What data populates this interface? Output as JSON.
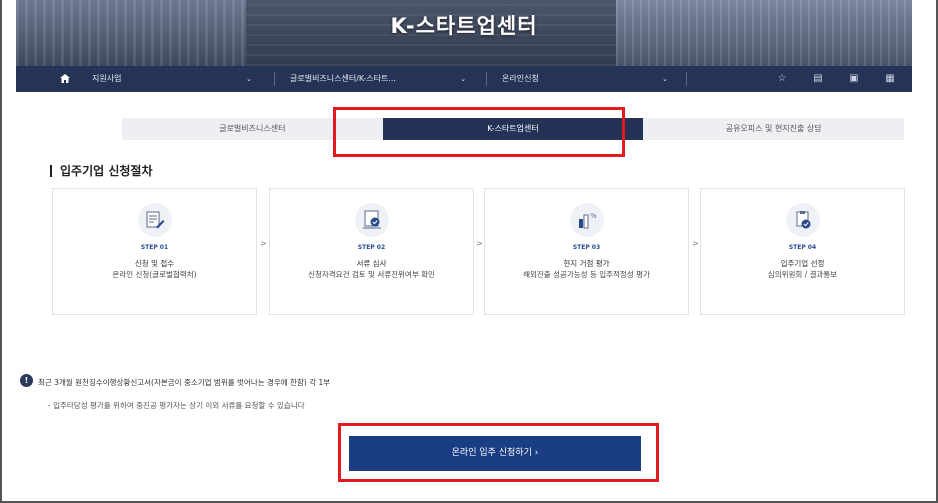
{
  "hero": {
    "title": "K-스타트업센터"
  },
  "nav": {
    "segments": [
      {
        "label": "지원사업"
      },
      {
        "label": "글로벌비즈니스센터/K-스타트..."
      },
      {
        "label": "온라인신청"
      }
    ],
    "icons": [
      "star-icon",
      "print-icon",
      "share-icon",
      "bookmark-icon"
    ]
  },
  "tabs": [
    {
      "label": "글로벌비즈니스센터"
    },
    {
      "label": "K-스타트업센터"
    },
    {
      "label": "공유오피스 및 현지진출 상담"
    }
  ],
  "section": {
    "title": "입주기업 신청절차"
  },
  "steps": [
    {
      "step": "STEP 01",
      "name": "신청 및 접수",
      "desc": "온라인 신청(글로벌협력처)"
    },
    {
      "step": "STEP 02",
      "name": "서류 심사",
      "desc": "신청자격요건 검토 및 서류진위여부 확인"
    },
    {
      "step": "STEP 03",
      "name": "현지 거점 평가",
      "desc": "해외진출 성공가능성 등 입주적정성 평가"
    },
    {
      "step": "STEP 04",
      "name": "입주기업 선정",
      "desc": "심의위원회 / 결과통보"
    }
  ],
  "arrow": ">",
  "notice": {
    "line1": "최근 3개월 원천징수이행상황신고서(자본금이 중소기업 범위를 벗어나는 경우에 한함) 각 1부",
    "line2": "- 입주타당성 평가를 위하여 중진공 평가자는 상기 이외 서류를 요청할 수 있습니다"
  },
  "cta": {
    "label": "온라인 입주 신청하기 ›"
  },
  "colors": {
    "navy": "#243356",
    "accent": "#1a3d84",
    "highlight": "#e11a22"
  }
}
